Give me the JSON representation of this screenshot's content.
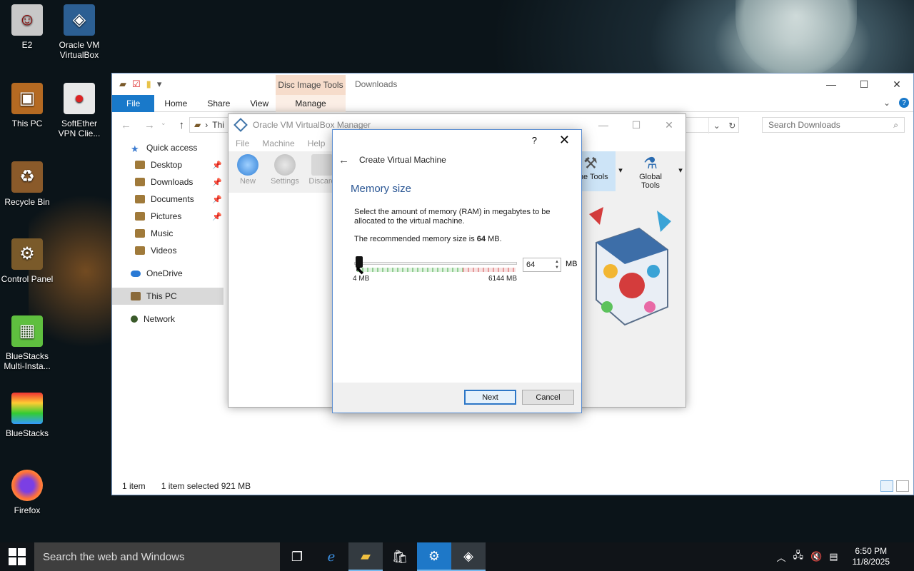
{
  "desktop": {
    "icons": [
      {
        "label": "E2"
      },
      {
        "label": "Oracle VM VirtualBox"
      },
      {
        "label": "This PC"
      },
      {
        "label": "SoftEther VPN Clie..."
      },
      {
        "label": "Recycle Bin"
      },
      {
        "label": "Control Panel"
      },
      {
        "label": "BlueStacks Multi-Insta..."
      },
      {
        "label": "BlueStacks"
      },
      {
        "label": "Firefox"
      }
    ]
  },
  "explorer": {
    "context_tab": "Disc Image Tools",
    "title": "Downloads",
    "tabs": {
      "file": "File",
      "home": "Home",
      "share": "Share",
      "view": "View",
      "manage": "Manage"
    },
    "address_partial": "Thi",
    "search_placeholder": "Search Downloads",
    "nav": [
      {
        "label": "Quick access"
      },
      {
        "label": "Desktop"
      },
      {
        "label": "Downloads"
      },
      {
        "label": "Documents"
      },
      {
        "label": "Pictures"
      },
      {
        "label": "Music"
      },
      {
        "label": "Videos"
      },
      {
        "label": "OneDrive"
      },
      {
        "label": "This PC"
      },
      {
        "label": "Network"
      }
    ],
    "status": {
      "count": "1 item",
      "selected": "1 item selected 921 MB"
    }
  },
  "vbox": {
    "title": "Oracle VM VirtualBox Manager",
    "menu": {
      "file": "File",
      "machine": "Machine",
      "help": "Help"
    },
    "toolbar": {
      "new": "New",
      "settings": "Settings",
      "discard": "Discard",
      "machine_tools": "hine Tools",
      "global_tools": "Global Tools"
    }
  },
  "dialog": {
    "help": "?",
    "close": "✕",
    "header": "Create Virtual Machine",
    "title": "Memory size",
    "description": "Select the amount of memory (RAM) in megabytes to be allocated to the virtual machine.",
    "recommend_prefix": "The recommended memory size is",
    "recommend_value": "64",
    "recommend_suffix": "MB.",
    "memory_value": "64",
    "unit": "MB",
    "min_label": "4 MB",
    "max_label": "6144 MB",
    "slider_fraction": 0.0098,
    "next": "Next",
    "cancel": "Cancel"
  },
  "taskbar": {
    "search": "Search the web and Windows",
    "time": "6:50 PM",
    "date": "11/8/2025"
  },
  "colors": {
    "accent": "#1979ca",
    "context_tab": "#f6dccb",
    "dialog_title": "#2a5694",
    "taskbar": "#101418"
  }
}
